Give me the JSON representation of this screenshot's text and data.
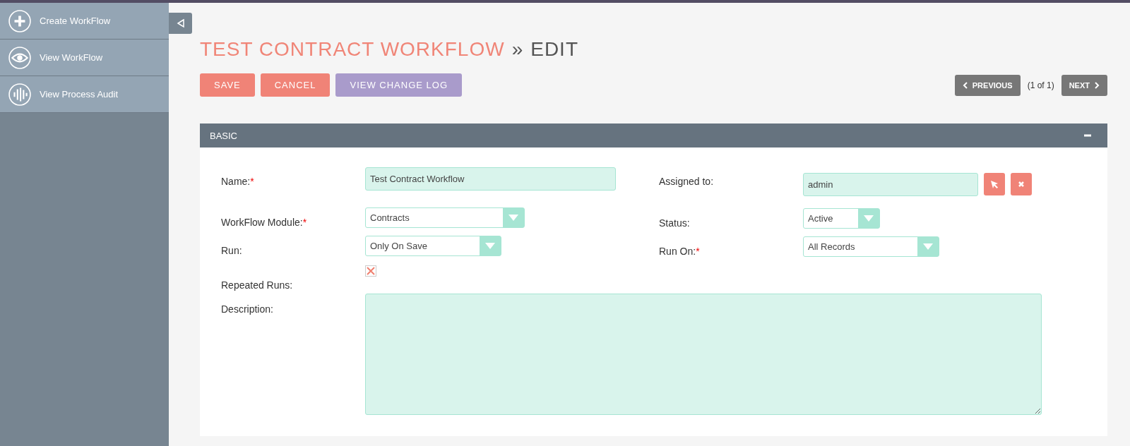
{
  "sidebar": {
    "items": [
      {
        "label": "Create WorkFlow",
        "kind": "plus"
      },
      {
        "label": "View WorkFlow",
        "kind": "eye"
      },
      {
        "label": "View Process Audit",
        "kind": "audit"
      }
    ]
  },
  "title": {
    "module": "TEST CONTRACT WORKFLOW",
    "separator": "»",
    "action": "EDIT"
  },
  "actions": [
    {
      "label": "SAVE",
      "kind": "primary"
    },
    {
      "label": "CANCEL",
      "kind": "primary"
    },
    {
      "label": "VIEW CHANGE LOG",
      "kind": "secondary"
    }
  ],
  "pagination": {
    "previous": "PREVIOUS",
    "count": "(1 of 1)",
    "next": "NEXT"
  },
  "panel": {
    "title": "BASIC",
    "expanded": true,
    "left": [
      {
        "label": "Name:",
        "required_mark": "*",
        "kind": "text",
        "value": "Test Contract Workflow"
      },
      {
        "label": "WorkFlow Module:",
        "required_mark": "*",
        "kind": "select",
        "value": "Contracts"
      },
      {
        "label": "Run:",
        "kind": "select",
        "value": "Only On Save"
      },
      {
        "label": "Repeated Runs:",
        "kind": "checkbox",
        "checked": true
      }
    ],
    "right": [
      {
        "label": "Assigned to:",
        "kind": "relate",
        "value": "admin"
      },
      {
        "label": "Status:",
        "kind": "select",
        "value": "Active"
      },
      {
        "label": "Run On:",
        "required_mark": "*",
        "kind": "select",
        "value": "All Records"
      }
    ],
    "description": {
      "label": "Description:"
    }
  }
}
